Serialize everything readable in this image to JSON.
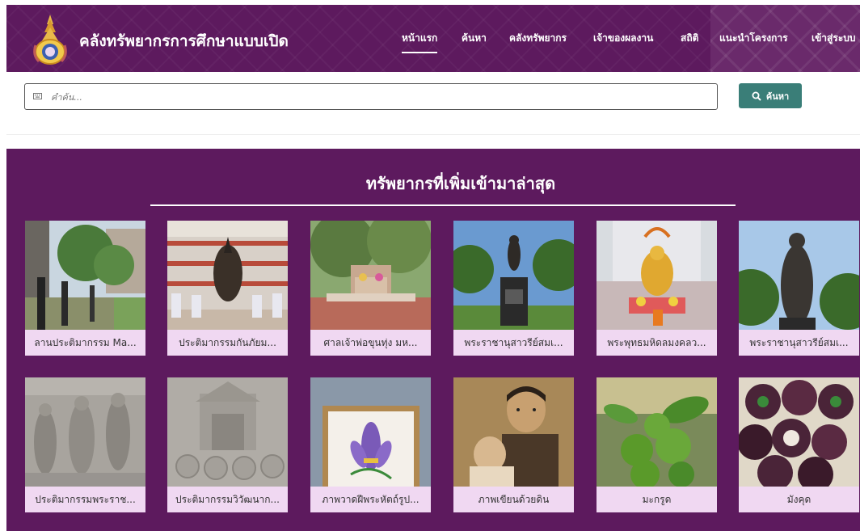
{
  "header": {
    "site_title": "คลังทรัพยากรการศึกษาแบบเปิด",
    "logo_icon": "royal-crest-icon",
    "nav": [
      {
        "label": "หน้าแรก",
        "active": true
      },
      {
        "label": "ค้นหา",
        "active": false
      },
      {
        "label": "คลังทรัพยากร",
        "active": false
      },
      {
        "label": "เจ้าของผลงาน",
        "active": false
      },
      {
        "label": "สถิติ",
        "active": false
      },
      {
        "label": "แนะนำโครงการ",
        "active": false
      },
      {
        "label": "เข้าสู่ระบบ",
        "active": false
      }
    ]
  },
  "search": {
    "placeholder": "คำค้น...",
    "value": "",
    "button_label": "ค้นหา",
    "button_icon": "search-icon",
    "input_icon": "keyboard-icon"
  },
  "resources": {
    "title": "ทรัพยากรที่เพิ่มเข้ามาล่าสุด",
    "items": [
      {
        "caption": "ลานประติมากรรม Ma..."
      },
      {
        "caption": "ประติมากรรมกันภัยม..."
      },
      {
        "caption": "ศาลเจ้าพ่อขุนทุ่ง มห..."
      },
      {
        "caption": "พระราชานุสาวรีย์สมเ..."
      },
      {
        "caption": "พระพุทธมหิดลมงคลว..."
      },
      {
        "caption": "พระราชานุสาวรีย์สมเ..."
      },
      {
        "caption": "ประติมากรรมพระราช..."
      },
      {
        "caption": "ประติมากรรมวิวัฒนาก..."
      },
      {
        "caption": "ภาพวาดฝีพระหัตถ์รูป..."
      },
      {
        "caption": "ภาพเขียนด้วยดิน"
      },
      {
        "caption": "มะกรูด"
      },
      {
        "caption": "มังคุด"
      }
    ]
  },
  "colors": {
    "brand_purple": "#5d1a5e",
    "search_button": "#3a7e78",
    "caption_bg": "#f0d8f2"
  }
}
